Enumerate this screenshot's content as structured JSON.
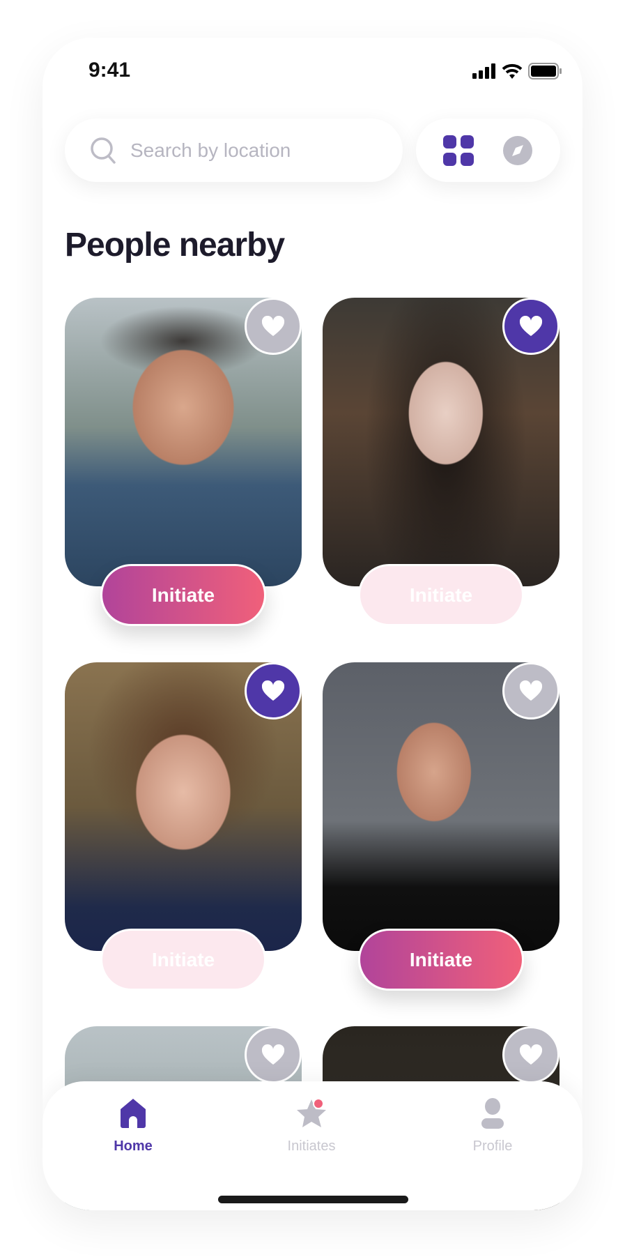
{
  "status_bar": {
    "time": "9:41"
  },
  "search": {
    "placeholder": "Search by location"
  },
  "view_toggle": {
    "grid": "grid-icon",
    "map": "compass-icon",
    "active": "grid"
  },
  "heading": "People nearby",
  "colors": {
    "accent": "#4F37A8",
    "gradient_start": "#B1449A",
    "gradient_end": "#F0607A",
    "inactive": "#BDBCC6"
  },
  "people": [
    {
      "liked": false,
      "button": "Initiate",
      "button_active": true
    },
    {
      "liked": true,
      "button": "Initiate",
      "button_active": false
    },
    {
      "liked": true,
      "button": "Initiate",
      "button_active": false
    },
    {
      "liked": false,
      "button": "Initiate",
      "button_active": true
    },
    {
      "liked": false
    },
    {
      "liked": false
    }
  ],
  "nav": {
    "items": [
      {
        "label": "Home",
        "icon": "home-icon",
        "active": true
      },
      {
        "label": "Initiates",
        "icon": "star-icon",
        "badge": true
      },
      {
        "label": "Profile",
        "icon": "user-icon"
      }
    ]
  }
}
